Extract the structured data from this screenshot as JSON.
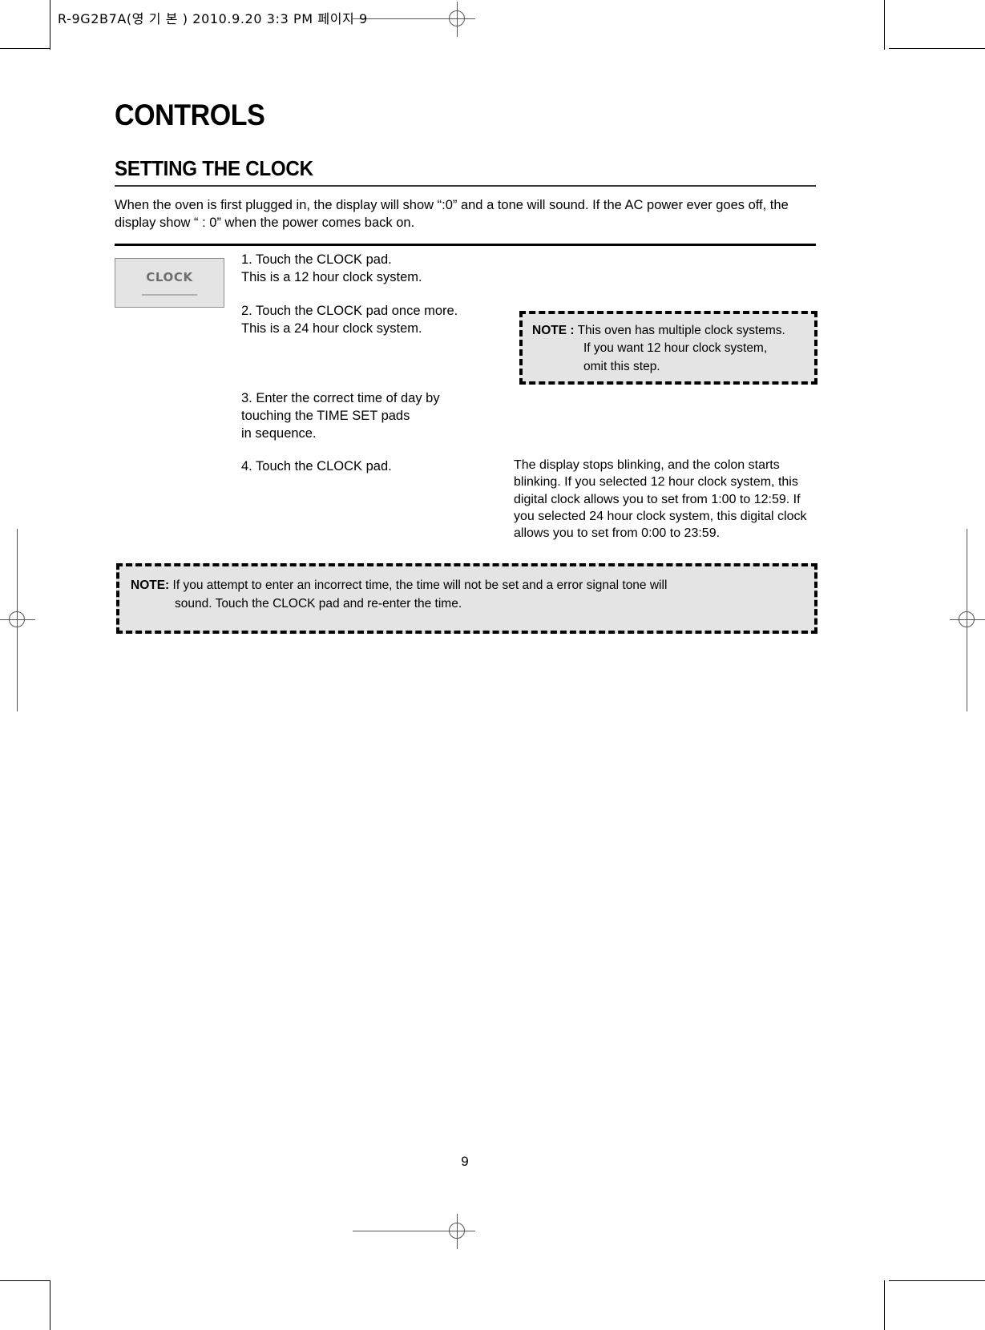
{
  "header_stamp": "R-9G2B7A(영 기 본 )  2010.9.20 3:3 PM  페이지 9",
  "document": {
    "title": "CONTROLS",
    "section_title": "SETTING THE CLOCK",
    "intro": "When the oven is first plugged in, the display will show “:0” and a tone will sound. If the AC power ever goes off, the display show “ : 0” when the power comes back on.",
    "page_number": "9"
  },
  "clock_pad": {
    "label": "CLOCK"
  },
  "steps": [
    {
      "number": "1.",
      "text": "1.  Touch the CLOCK pad.\n     This is a 12 hour clock system."
    },
    {
      "number": "2.",
      "text": "2. Touch the CLOCK pad once more.\n    This is a 24 hour clock system."
    },
    {
      "number": "3.",
      "text": "3. Enter the correct time of day by\n    touching the TIME SET pads\n    in sequence."
    },
    {
      "number": "4.",
      "text": "4. Touch the CLOCK pad."
    }
  ],
  "side_note": {
    "lead": "NOTE :",
    "line1": "This oven has multiple clock systems.",
    "line2": "If  you want 12 hour clock system,",
    "line3": "omit this step."
  },
  "explanation": "The display stops blinking, and the colon starts blinking.  If you selected 12 hour clock system, this digital clock allows you to set from 1:00 to 12:59.  If you selected 24 hour clock system, this digital clock allows you to set from 0:00 to 23:59.",
  "bottom_note": {
    "lead": "NOTE:",
    "line1": "If you attempt to enter an incorrect time, the time will not be set and a error signal tone will",
    "line2": "sound. Touch the CLOCK pad and re-enter the time."
  },
  "colors": {
    "pad_fill": "#e4e4e4",
    "note_fill": "#e4e4e4",
    "rule": "#000000"
  }
}
